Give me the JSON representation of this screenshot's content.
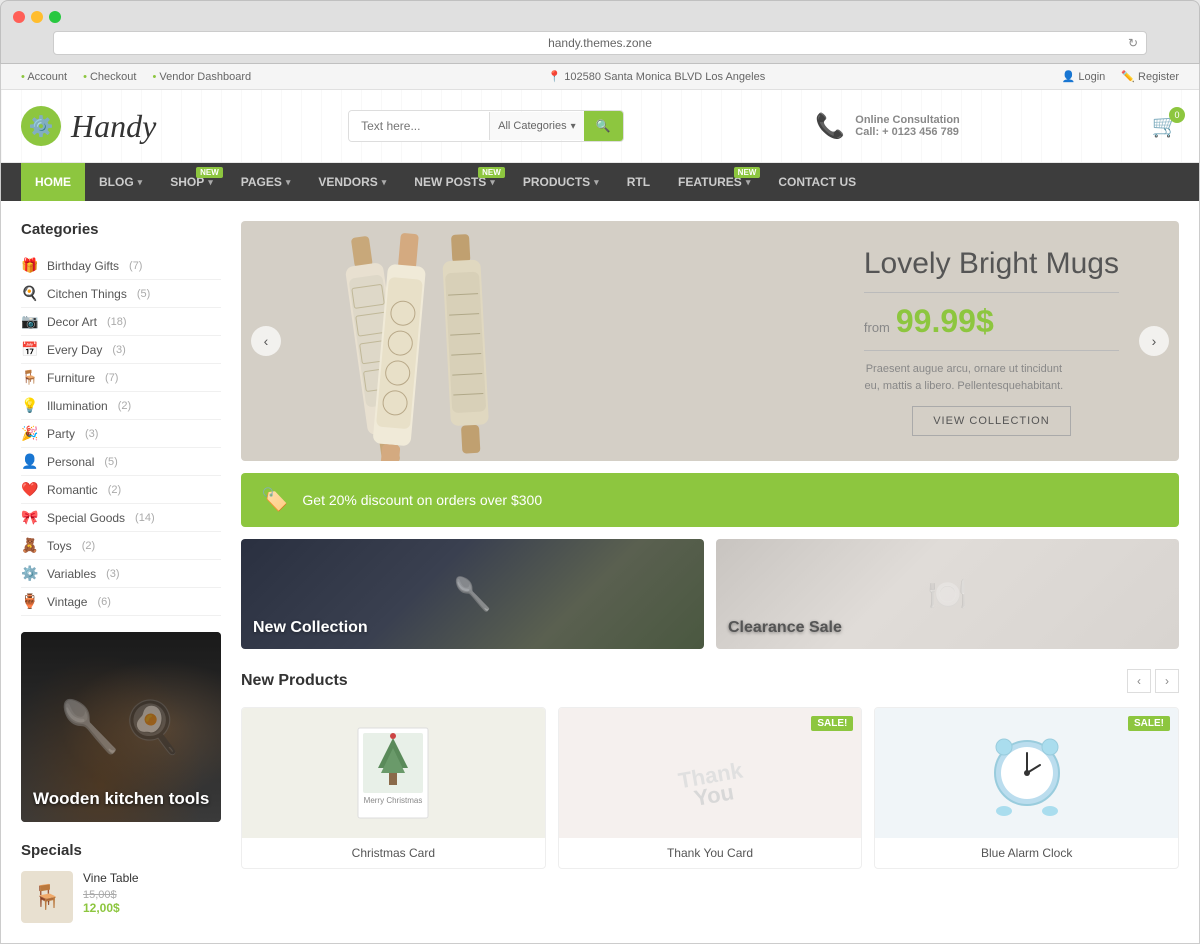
{
  "browser": {
    "url": "handy.themes.zone",
    "buttons": [
      "red",
      "yellow",
      "green"
    ]
  },
  "topbar": {
    "links": [
      "Account",
      "Checkout",
      "Vendor Dashboard"
    ],
    "address": "102580 Santa Monica BLVD Los Angeles",
    "auth": [
      "Login",
      "Register"
    ]
  },
  "header": {
    "logo_text": "Handy",
    "search_placeholder": "Text here...",
    "search_category": "All Categories",
    "consultation_title": "Online Consultation",
    "consultation_phone": "Call: + 0123 456 789",
    "cart_count": "0"
  },
  "nav": {
    "items": [
      {
        "label": "HOME",
        "active": true,
        "has_dropdown": false
      },
      {
        "label": "BLOG",
        "active": false,
        "has_dropdown": true,
        "badge": ""
      },
      {
        "label": "SHOP",
        "active": false,
        "has_dropdown": true,
        "badge": "NEW"
      },
      {
        "label": "PAGES",
        "active": false,
        "has_dropdown": true,
        "badge": ""
      },
      {
        "label": "VENDORS",
        "active": false,
        "has_dropdown": true,
        "badge": ""
      },
      {
        "label": "NEW POSTS",
        "active": false,
        "has_dropdown": true,
        "badge": "NEW"
      },
      {
        "label": "PRODUCTS",
        "active": false,
        "has_dropdown": true,
        "badge": ""
      },
      {
        "label": "RTL",
        "active": false,
        "has_dropdown": false,
        "badge": ""
      },
      {
        "label": "FEATURES",
        "active": false,
        "has_dropdown": true,
        "badge": "NEW"
      },
      {
        "label": "CONTACT US",
        "active": false,
        "has_dropdown": false,
        "badge": ""
      }
    ]
  },
  "sidebar": {
    "categories_title": "Categories",
    "categories": [
      {
        "name": "Birthday Gifts",
        "count": "(7)",
        "icon": "🎁"
      },
      {
        "name": "Citchen Things",
        "count": "(5)",
        "icon": "🍳"
      },
      {
        "name": "Decor Art",
        "count": "(18)",
        "icon": "📷"
      },
      {
        "name": "Every Day",
        "count": "(3)",
        "icon": "📅"
      },
      {
        "name": "Furniture",
        "count": "(7)",
        "icon": "🪑"
      },
      {
        "name": "Illumination",
        "count": "(2)",
        "icon": "💡"
      },
      {
        "name": "Party",
        "count": "(3)",
        "icon": "👤"
      },
      {
        "name": "Personal",
        "count": "(5)",
        "icon": "👤"
      },
      {
        "name": "Romantic",
        "count": "(2)",
        "icon": "❤️"
      },
      {
        "name": "Special Goods",
        "count": "(14)",
        "icon": "🎀"
      },
      {
        "name": "Toys",
        "count": "(2)",
        "icon": "🧸"
      },
      {
        "name": "Variables",
        "count": "(3)",
        "icon": "⚙️"
      },
      {
        "name": "Vintage",
        "count": "(6)",
        "icon": "🏺"
      }
    ],
    "promo_text": "Wooden kitchen tools",
    "specials_title": "Specials",
    "special_item": {
      "name": "Vine Table",
      "price_old": "15,00$",
      "price_new": "12,00$"
    }
  },
  "hero": {
    "title": "Lovely Bright Mugs",
    "price_label": "from",
    "price": "99.99$",
    "description": "Praesent augue arcu, ornare ut tincidunt eu, mattis a libero. Pellentesquehabitant.",
    "btn_label": "VIEW COLLECTION"
  },
  "discount": {
    "text": "Get 20% discount on orders over $300"
  },
  "promo_cards": [
    {
      "label": "New Collection"
    },
    {
      "label": "Clearance Sale"
    }
  ],
  "new_products": {
    "title": "New Products",
    "sale_label": "SALE!",
    "products": [
      {
        "name": "Christmas Card",
        "icon": "🏠",
        "has_sale": false
      },
      {
        "name": "Thank You Card",
        "icon": "✍️",
        "has_sale": true
      },
      {
        "name": "Blue Alarm Clock",
        "icon": "⏰",
        "has_sale": true
      }
    ]
  },
  "icons": {
    "logo": "⚙️",
    "search": "🔍",
    "phone": "📞",
    "cart": "🛒",
    "user": "👤",
    "edit": "✏️",
    "location": "📍",
    "tag": "🏷️",
    "arrow_left": "‹",
    "arrow_right": "›"
  }
}
